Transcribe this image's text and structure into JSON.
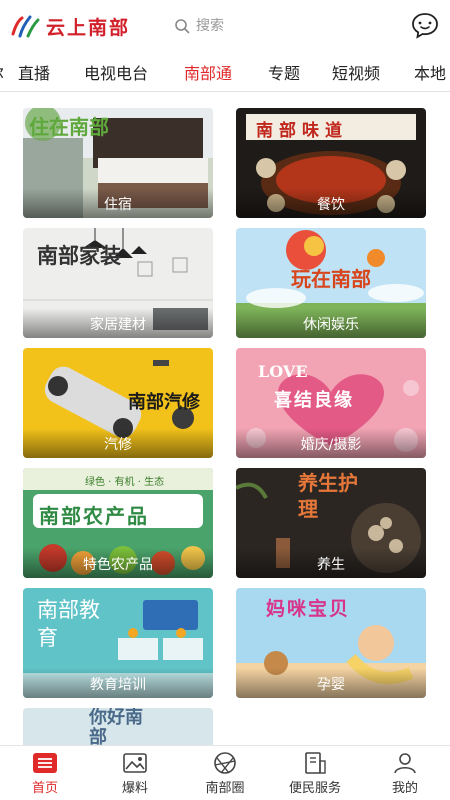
{
  "header": {
    "brand": "云上南部",
    "search_placeholder": "搜索"
  },
  "tabs": [
    {
      "label": "直播"
    },
    {
      "label": "电视电台"
    },
    {
      "label": "南部通"
    },
    {
      "label": "专题"
    },
    {
      "label": "短视频"
    },
    {
      "label": "本地"
    }
  ],
  "active_tab": "南部通",
  "cards": [
    {
      "label": "住宿",
      "art_text": "住在南部"
    },
    {
      "label": "餐饮",
      "art_text": "南部味道"
    },
    {
      "label": "家居建材",
      "art_text": "南部家装"
    },
    {
      "label": "休闲娱乐",
      "art_text": "玩在南部"
    },
    {
      "label": "汽修",
      "art_text": "南部汽修"
    },
    {
      "label": "婚庆/摄影",
      "art_text": "喜结良缘",
      "art_text_en": "LOVE"
    },
    {
      "label": "特色农产品",
      "art_text": "南部农产品",
      "art_subtext": "绿色 · 有机 · 生态"
    },
    {
      "label": "养生",
      "art_text": "养生护理"
    },
    {
      "label": "教育培训",
      "art_text": "南部教育"
    },
    {
      "label": "孕婴",
      "art_text": "妈咪宝贝"
    },
    {
      "label": "",
      "art_text": "你好南部"
    }
  ],
  "bottom_nav": [
    {
      "label": "首页",
      "icon": "home-icon"
    },
    {
      "label": "爆料",
      "icon": "image-report-icon"
    },
    {
      "label": "南部圈",
      "icon": "aperture-icon"
    },
    {
      "label": "便民服务",
      "icon": "service-icon"
    },
    {
      "label": "我的",
      "icon": "user-icon"
    }
  ],
  "colors": {
    "accent": "#e02a2a",
    "brand": "#d1202a"
  }
}
